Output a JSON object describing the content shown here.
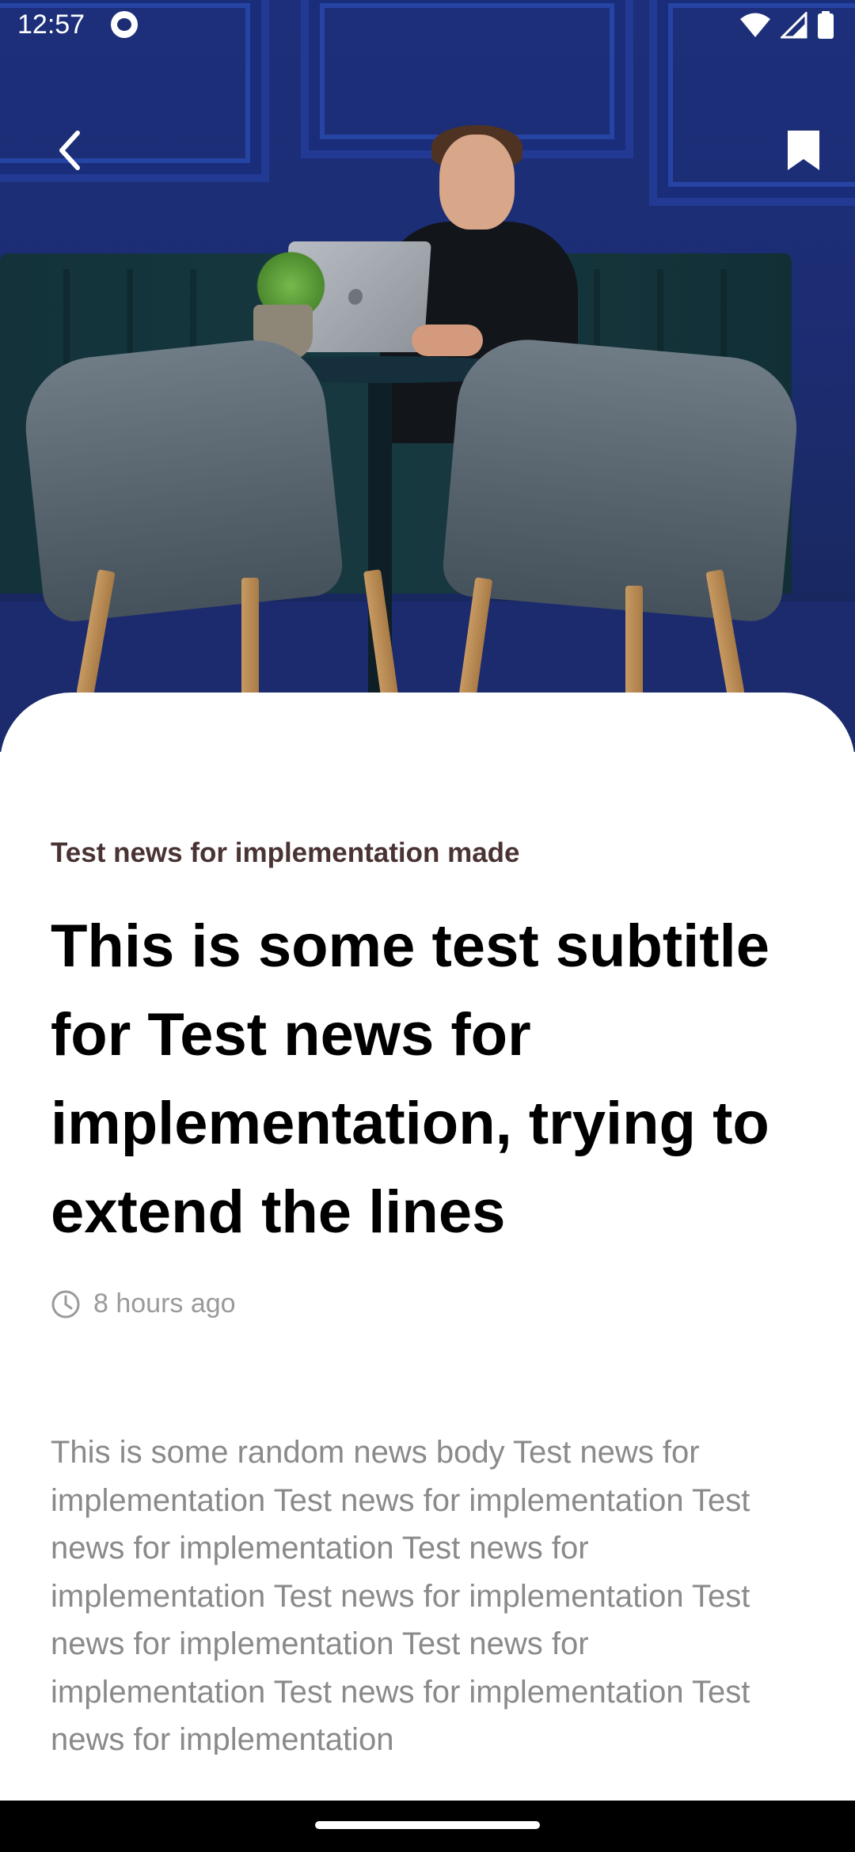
{
  "status_bar": {
    "time": "12:57",
    "icons": [
      "app-notification-icon",
      "wifi-icon",
      "cellular-signal-icon",
      "battery-icon"
    ]
  },
  "toolbar": {
    "back_icon": "chevron-left-icon",
    "bookmark_icon": "bookmark-icon"
  },
  "article": {
    "category": "Test news for implementation made",
    "headline": "This is some test subtitle for Test news for implementation, trying to extend the lines",
    "time_icon": "clock-icon",
    "published_ago": "8 hours ago",
    "body": "This is some random news body Test news for implementation Test news for implementation Test news for implementation Test news for implementation Test news for implementation Test news for implementation Test news for implementation Test news for implementation Test news for implementation"
  },
  "colors": {
    "hero_blue": "#1c2d74",
    "category_text": "#4a3333",
    "headline_text": "#000000",
    "meta_text": "#9a9a9a",
    "body_text": "#8a8a8a"
  }
}
